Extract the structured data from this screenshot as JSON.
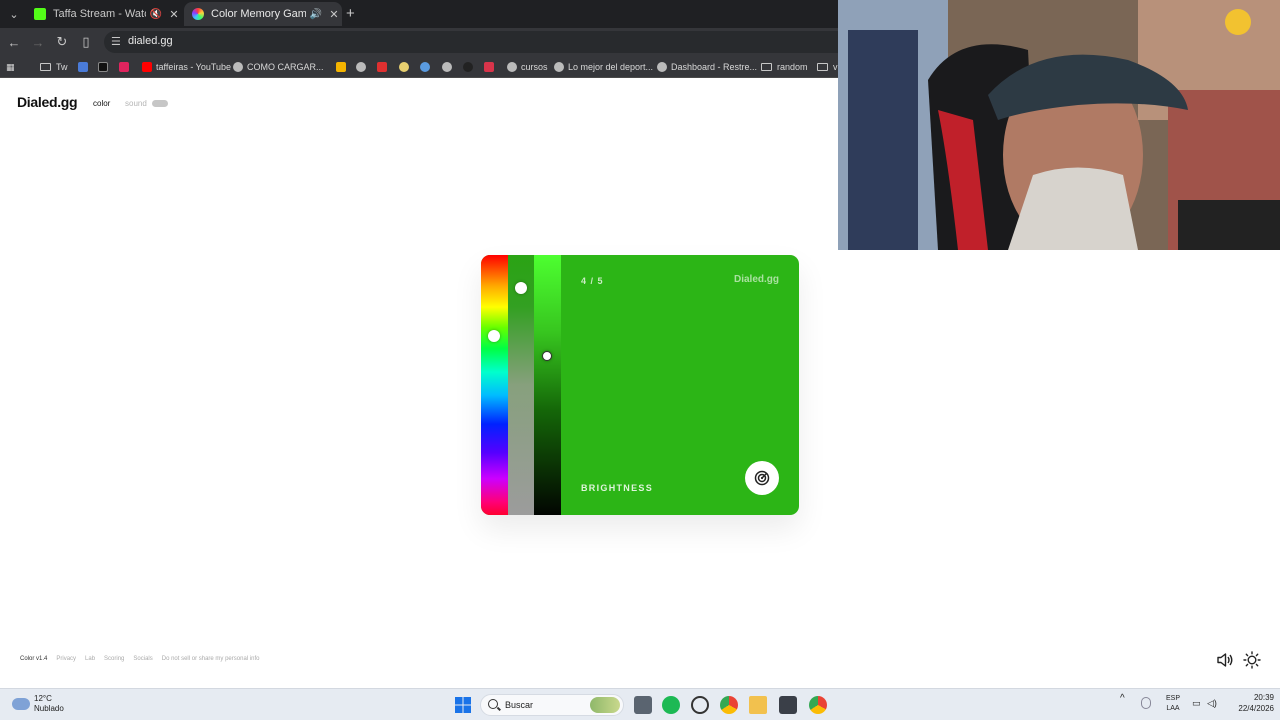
{
  "browser": {
    "tabs": [
      {
        "title": "Taffa Stream - Watch Live o",
        "favicon_color": "#53fc18",
        "active": false,
        "muted": true
      },
      {
        "title": "Color Memory Game — Ho",
        "favicon_color": "#e04f9a",
        "active": true,
        "muted": false
      }
    ],
    "url": "dialed.gg",
    "bookmarks": [
      "Tw",
      "taffeiras - YouTube",
      "COMO CARGAR...",
      "cursos",
      "Lo mejor del deport...",
      "Dashboard - Restre...",
      "random",
      "vi"
    ]
  },
  "page": {
    "logo": "Dialed.gg",
    "nav": {
      "color": "color",
      "sound": "sound"
    },
    "card": {
      "counter": "4 / 5",
      "brand": "Dialed.gg",
      "label": "BRIGHTNESS",
      "color": "#2cb516",
      "hue_level": 0.31,
      "saturation_level": 0.12,
      "brightness_level": 0.39
    },
    "footer": {
      "version": "Color v1.4",
      "links": [
        "Privacy",
        "Lab",
        "Scoring",
        "Socials",
        "Do not sell or share my personal info"
      ]
    }
  },
  "taskbar": {
    "weather_temp": "12°C",
    "weather_desc": "Nublado",
    "search_placeholder": "Buscar",
    "lang_top": "ESP",
    "lang_bottom": "LAA",
    "time": "20:39",
    "date": "22/4/2026"
  }
}
